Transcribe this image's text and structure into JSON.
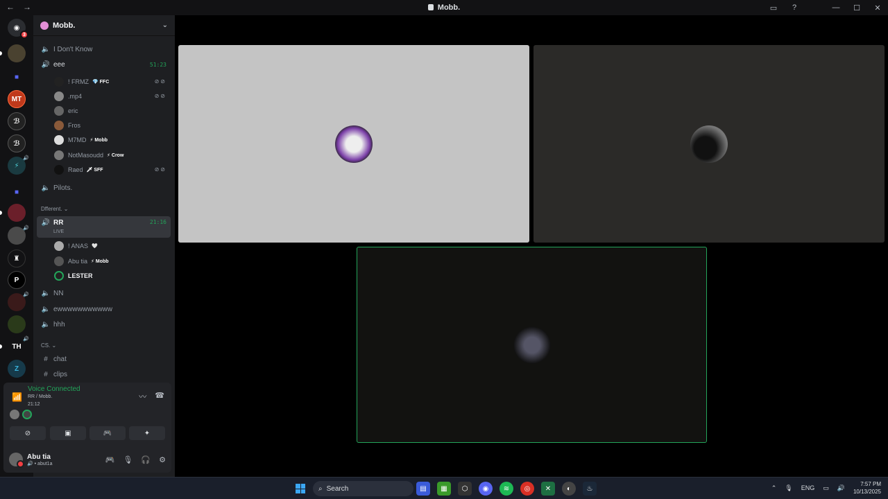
{
  "window": {
    "title": "Mobb.",
    "nav_back": "←",
    "nav_fwd": "→",
    "inbox_icon": "inbox-icon",
    "help_icon": "?",
    "minimize": "—",
    "maximize": "☐",
    "close": "✕"
  },
  "rail": {
    "badge": "3"
  },
  "server": {
    "name": "Mobb.",
    "chevron": "⌄"
  },
  "channels": [
    {
      "name": "I Don't Know",
      "type": "voice"
    },
    {
      "name": "eee",
      "type": "voice",
      "time": "51:23"
    },
    {
      "name": "Pilots.",
      "type": "voice"
    },
    {
      "name": "RR",
      "type": "voice",
      "time": "21:16",
      "live": "LIVE"
    },
    {
      "name": "NN",
      "type": "voice"
    },
    {
      "name": "ewwwwwwwwwww",
      "type": "voice"
    },
    {
      "name": "hhh",
      "type": "voice"
    },
    {
      "name": "chat",
      "type": "text"
    },
    {
      "name": "clips",
      "type": "text"
    }
  ],
  "categories": {
    "different": "Dfferent. ⌄",
    "cs": "CS. ⌄"
  },
  "eee_users": [
    {
      "name": "! FRMZ",
      "tag": "💎 FFC",
      "muted": true
    },
    {
      "name": ".mp4",
      "tag": "",
      "muted": true
    },
    {
      "name": "eric",
      "tag": "",
      "muted": false
    },
    {
      "name": "Fros",
      "tag": "",
      "muted": false
    },
    {
      "name": "M7MD",
      "tag": "⚡ Mobb",
      "muted": false
    },
    {
      "name": "NotMasoudd",
      "tag": "⚡ Crow",
      "muted": false
    },
    {
      "name": "Raed",
      "tag": "🗡 SFF",
      "muted": true
    }
  ],
  "rr_users": [
    {
      "name": "! ANAS",
      "tag": "🤍"
    },
    {
      "name": "Abu tia",
      "tag": "⚡ Mobb"
    },
    {
      "name": "LESTER",
      "tag": ""
    }
  ],
  "voice_status": {
    "title": "Voice Connected",
    "location": "RR / Mobb.",
    "elapsed": "21:12"
  },
  "account": {
    "name": "Abu tia",
    "status": "🔊 • abut1a"
  },
  "colors": {
    "accent_green": "#23a55a",
    "rail_bg": "#121214",
    "channel_bg": "#1e1f22",
    "tile_light": "#c4c4c4",
    "tile_dark": "#2b2a28"
  },
  "taskbar": {
    "search_placeholder": "Search",
    "lang": "ENG",
    "time": "7:57 PM",
    "date": "10/13/2025"
  }
}
